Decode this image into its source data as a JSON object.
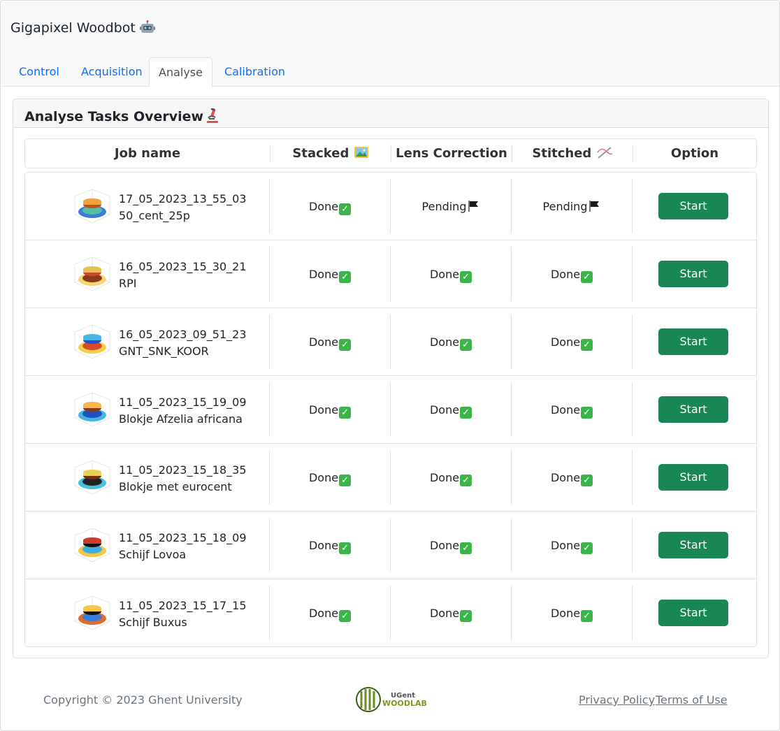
{
  "app": {
    "title": "Gigapixel Woodbot"
  },
  "tabs": [
    {
      "label": "Control"
    },
    {
      "label": "Acquisition"
    },
    {
      "label": "Analyse"
    },
    {
      "label": "Calibration"
    }
  ],
  "active_tab": "Analyse",
  "card": {
    "title": "Analyse Tasks Overview"
  },
  "table": {
    "headers": {
      "job_name": "Job name",
      "stacked": "Stacked",
      "lens_correction": "Lens Correction",
      "stitched": "Stitched",
      "option": "Option"
    },
    "rows": [
      {
        "job_id": "17_05_2023_13_55_03",
        "job_label": "50_cent_25p",
        "stacked": "Done",
        "lens_correction": "Pending",
        "stitched": "Pending",
        "action": "Start"
      },
      {
        "job_id": "16_05_2023_15_30_21",
        "job_label": "RPI",
        "stacked": "Done",
        "lens_correction": "Done",
        "stitched": "Done",
        "action": "Start"
      },
      {
        "job_id": "16_05_2023_09_51_23",
        "job_label": "GNT_SNK_KOOR",
        "stacked": "Done",
        "lens_correction": "Done",
        "stitched": "Done",
        "action": "Start"
      },
      {
        "job_id": "11_05_2023_15_19_09",
        "job_label": "Blokje Afzelia africana",
        "stacked": "Done",
        "lens_correction": "Done",
        "stitched": "Done",
        "action": "Start"
      },
      {
        "job_id": "11_05_2023_15_18_35",
        "job_label": "Blokje met eurocent",
        "stacked": "Done",
        "lens_correction": "Done",
        "stitched": "Done",
        "action": "Start"
      },
      {
        "job_id": "11_05_2023_15_18_09",
        "job_label": "Schijf Lovoa",
        "stacked": "Done",
        "lens_correction": "Done",
        "stitched": "Done",
        "action": "Start"
      },
      {
        "job_id": "11_05_2023_15_17_15",
        "job_label": "Schijf Buxus",
        "stacked": "Done",
        "lens_correction": "Done",
        "stitched": "Done",
        "action": "Start"
      }
    ]
  },
  "footer": {
    "copyright": "Copyright © 2023 Ghent University",
    "logo_line1": "UGent",
    "logo_line2": "WOODLAB",
    "privacy": "Privacy Policy",
    "terms": "Terms of Use"
  },
  "colors": {
    "primary_link": "#0d6efd",
    "success": "#198754",
    "check_green": "#3bb54a"
  }
}
